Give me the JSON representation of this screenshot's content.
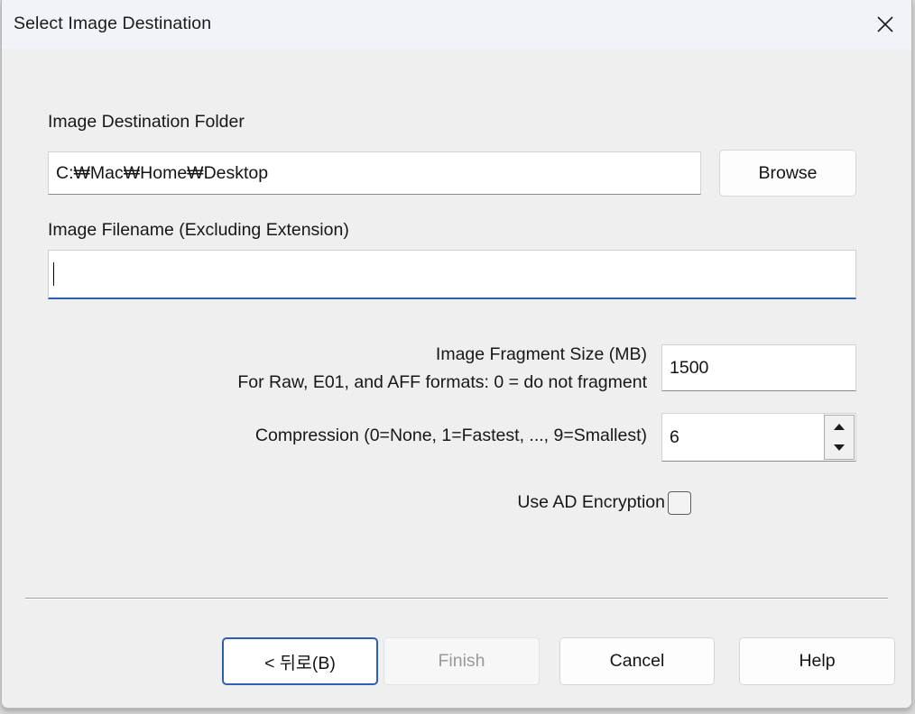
{
  "window": {
    "title": "Select Image Destination",
    "close_icon": "close-icon"
  },
  "form": {
    "destination_folder": {
      "label": "Image Destination Folder",
      "value": "C:₩Mac₩Home₩Desktop",
      "browse_label": "Browse"
    },
    "filename": {
      "label": "Image Filename (Excluding Extension)",
      "value": "",
      "focused": true
    },
    "fragment_size": {
      "label_line1": "Image Fragment Size (MB)",
      "label_line2": "For Raw, E01, and AFF formats: 0 = do not fragment",
      "value": "1500"
    },
    "compression": {
      "label": "Compression (0=None, 1=Fastest, ..., 9=Smallest)",
      "value": "6",
      "up_icon": "spinner-up-icon",
      "down_icon": "spinner-down-icon"
    },
    "ad_encryption": {
      "label": "Use AD Encryption",
      "checked": false
    }
  },
  "footer": {
    "back_label": "< 뒤로(B)",
    "finish_label": "Finish",
    "finish_disabled": true,
    "cancel_label": "Cancel",
    "help_label": "Help"
  },
  "colors": {
    "accent": "#2f5fb4",
    "dialog_bg": "#efefef",
    "titlebar_bg": "#f0f3f8",
    "field_bg": "#ffffff",
    "disabled_text": "#9a9a9a"
  }
}
